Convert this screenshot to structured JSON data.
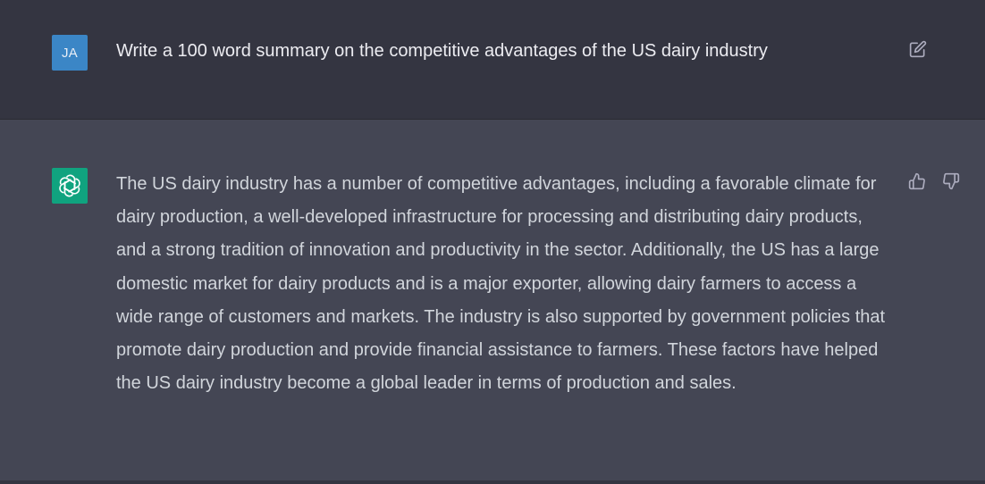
{
  "conversation": {
    "user": {
      "avatar_initials": "JA",
      "message": "Write a 100 word summary on the competitive advantages of the US dairy industry",
      "edit_icon": "edit-icon"
    },
    "assistant": {
      "avatar_icon": "openai-logo-icon",
      "message": "The US dairy industry has a number of competitive advantages, including a favorable climate for dairy production, a well-developed infrastructure for processing and distributing dairy products, and a strong tradition of innovation and productivity in the sector. Additionally, the US has a large domestic market for dairy products and is a major exporter, allowing dairy farmers to access a wide range of customers and markets. The industry is also supported by government policies that promote dairy production and provide financial assistance to farmers. These factors have helped the US dairy industry become a global leader in terms of production and sales.",
      "feedback_icons": [
        "thumbs-up-icon",
        "thumbs-down-icon"
      ]
    }
  },
  "colors": {
    "user_bg": "#343541",
    "assistant_bg": "#444654",
    "user_avatar": "#3b86c6",
    "assistant_avatar": "#10a37f",
    "text_primary": "#ececf1",
    "text_secondary": "#d1d5db",
    "icon": "#acacbe"
  }
}
